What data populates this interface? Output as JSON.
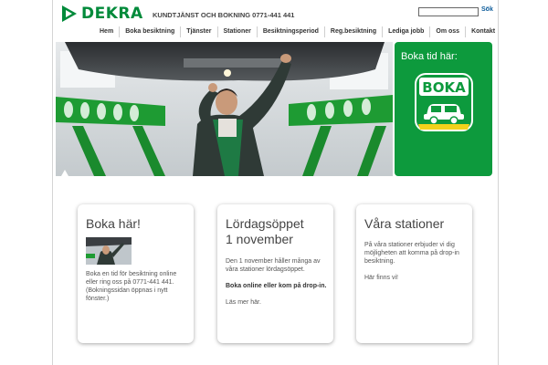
{
  "header": {
    "logo_text": "DEKRA",
    "contact": "KUNDTJÄNST OCH BOKNING 0771-441 441",
    "search_placeholder": "",
    "search_button": "Sök"
  },
  "nav": [
    "Hem",
    "Boka besiktning",
    "Tjänster",
    "Stationer",
    "Besiktningsperiod",
    "Reg.besiktning",
    "Lediga jobb",
    "Om oss",
    "Kontakt"
  ],
  "boka_panel": {
    "title": "Boka tid här:",
    "badge_text": "BOKA"
  },
  "cards": [
    {
      "title": "Boka här!",
      "paragraphs": [
        "Boka en tid för besiktning online eller ring oss på 0771-441 441. (Bokningssidan öppnas i nytt fönster.)"
      ]
    },
    {
      "title_line1": "Lördagsöppet",
      "title_line2": "1 november",
      "paragraph1": "Den 1 november håller många av våra stationer lördagsöppet.",
      "paragraph2": "Boka online eller kom på drop-in.",
      "link": "Läs mer här."
    },
    {
      "title": "Våra stationer",
      "paragraph1": "På våra stationer erbjuder vi dig möjligheten att komma på drop-in besiktning.",
      "link": "Här finns vi!"
    }
  ],
  "colors": {
    "brand_green": "#008a3a",
    "panel_green": "#0d9a3d",
    "badge_yellow": "#f2d21b"
  }
}
